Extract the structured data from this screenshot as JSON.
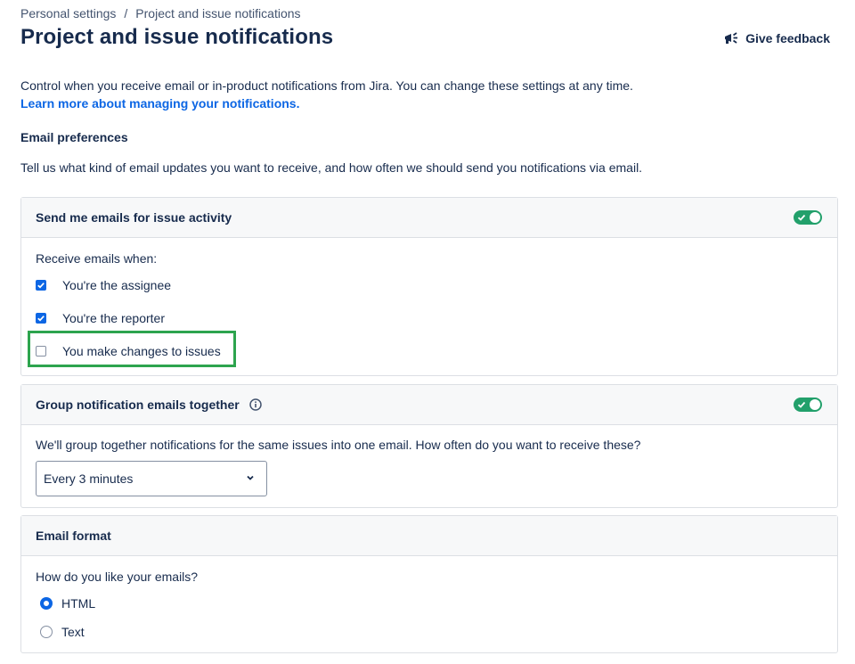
{
  "breadcrumb": {
    "items": [
      "Personal settings",
      "Project and issue notifications"
    ],
    "separator": "/"
  },
  "page_title": "Project and issue notifications",
  "feedback": {
    "label": "Give feedback",
    "icon": "megaphone-icon"
  },
  "intro": {
    "text": "Control when you receive email or in-product notifications from Jira. You can change these settings at any time.",
    "link": "Learn more about managing your notifications."
  },
  "email_preferences": {
    "heading": "Email preferences",
    "description": "Tell us what kind of email updates you want to receive, and how often we should send you notifications via email."
  },
  "issue_activity": {
    "title": "Send me emails for issue activity",
    "toggle_on": true,
    "prompt": "Receive emails when:",
    "options": [
      {
        "label": "You're the assignee",
        "checked": true
      },
      {
        "label": "You're the reporter",
        "checked": true
      },
      {
        "label": "You make changes to issues",
        "checked": false
      }
    ]
  },
  "grouping": {
    "title": "Group notification emails together",
    "info_icon": "info-icon",
    "toggle_on": true,
    "description": "We'll group together notifications for the same issues into one email. How often do you want to receive these?",
    "selected": "Every 3 minutes"
  },
  "email_format": {
    "title": "Email format",
    "prompt": "How do you like your emails?",
    "options": [
      {
        "label": "HTML",
        "selected": true
      },
      {
        "label": "Text",
        "selected": false
      }
    ]
  },
  "colors": {
    "accent": "#0c66e4",
    "toggle_on": "#22a06b",
    "highlight": "#2da44e"
  }
}
